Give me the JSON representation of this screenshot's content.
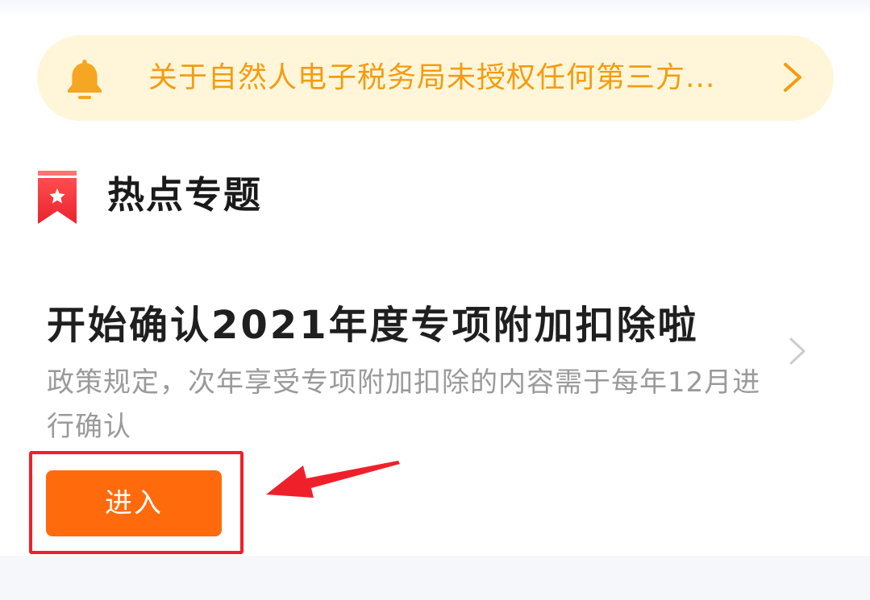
{
  "notice": {
    "icon": "bell-icon",
    "text": "关于自然人电子税务局未授权任何第三方...",
    "accent_color": "#f39c12",
    "background_color": "#fff6d9"
  },
  "section": {
    "icon": "bookmark-star-icon",
    "title": "热点专题"
  },
  "topic": {
    "title": "开始确认2021年度专项附加扣除啦",
    "description": "政策规定，次年享受专项附加扣除的内容需于每年12月进行确认",
    "button_label": "进入",
    "button_color": "#ff6a0d"
  },
  "annotation": {
    "highlight_color": "#f0202a"
  }
}
